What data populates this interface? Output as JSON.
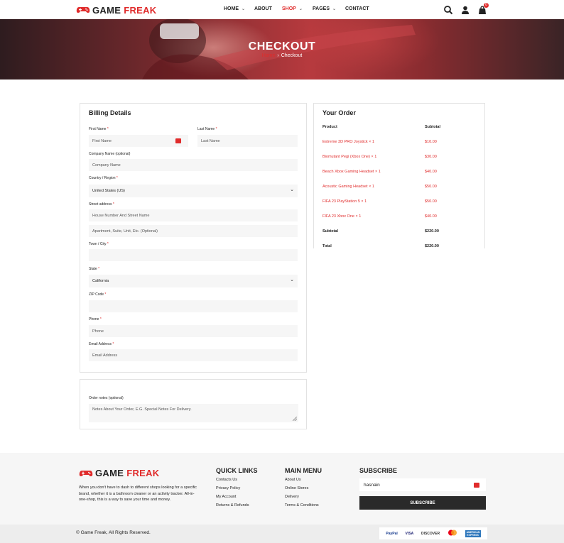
{
  "brand": {
    "word1": "GAME",
    "word2": "FREAK"
  },
  "nav": {
    "items": [
      {
        "label": "HOME",
        "dropdown": true
      },
      {
        "label": "ABOUT",
        "dropdown": false
      },
      {
        "label": "SHOP",
        "dropdown": true,
        "active": true
      },
      {
        "label": "PAGES",
        "dropdown": true
      },
      {
        "label": "CONTACT",
        "dropdown": false
      }
    ],
    "cart_count": "0"
  },
  "hero": {
    "title": "CHECKOUT",
    "crumb_home": "Home",
    "crumb_current": "Checkout"
  },
  "billing": {
    "title": "Billing Details",
    "first_name": {
      "label": "First Name",
      "placeholder": "First Name"
    },
    "last_name": {
      "label": "Last Name",
      "placeholder": "Last Name"
    },
    "company": {
      "label": "Company Name (optional)",
      "placeholder": "Company Name"
    },
    "country": {
      "label": "Country / Region",
      "value": "United States (US)"
    },
    "street": {
      "label": "Street address",
      "placeholder1": "House Number And Street Name",
      "placeholder2": "Apartment, Suite, Unit, Etc. (Optional)"
    },
    "city": {
      "label": "Town / City",
      "value": ""
    },
    "state": {
      "label": "State",
      "value": "California"
    },
    "zip": {
      "label": "ZIP Code",
      "value": ""
    },
    "phone": {
      "label": "Phone",
      "placeholder": "Phone"
    },
    "email": {
      "label": "Email Address",
      "placeholder": "Email Address"
    }
  },
  "notes": {
    "label": "Order notes (optional)",
    "placeholder": "Notes About Your Order, E.G. Special Notes For Delivery."
  },
  "order": {
    "title": "Your Order",
    "col_product": "Product",
    "col_subtotal": "Subtotal",
    "items": [
      {
        "name": "Extreme 3D PRO Joystick  × 1",
        "price": "$10.00"
      },
      {
        "name": "Biomutant Pegi (Xbox One)  × 1",
        "price": "$30.00"
      },
      {
        "name": "Beach Xbox Gaming Headset  × 1",
        "price": "$40.00"
      },
      {
        "name": "Acoustic Gaming Headset  × 1",
        "price": "$50.00"
      },
      {
        "name": "FIFA 23 PlayStation 5  × 1",
        "price": "$50.00"
      },
      {
        "name": "FIFA 23 Xbox One  × 1",
        "price": "$40.00"
      }
    ],
    "subtotal_label": "Subtotal",
    "subtotal_value": "$220.00",
    "total_label": "Total",
    "total_value": "$220.00"
  },
  "footer": {
    "description": "When you don't have to dash to different shops looking for a specific brand, whether it is a bathroom cleaner or an activity tracker. All-in-one-shop, this is a way to save your time and money.",
    "quick_links": {
      "title": "QUICK LINKS",
      "items": [
        "Contacts Us",
        "Privacy Policy",
        "My Account",
        "Returns & Refunds"
      ]
    },
    "main_menu": {
      "title": "MAIN MENU",
      "items": [
        "About Us",
        "Online Stores",
        "Delivery",
        "Terms & Conditions"
      ]
    },
    "subscribe": {
      "title": "SUBSCRIBE",
      "input_value": "hasnain",
      "button": "SUBSCRIBE"
    },
    "copyright": "© Game Freak, All Rights Reserved.",
    "payments": [
      "PayPal",
      "VISA",
      "DISCOVER",
      "mastercard",
      "AMERICAN EXPRESS"
    ]
  },
  "colors": {
    "accent": "#e02b2b",
    "dark": "#2a2a2a",
    "footer_bg": "#f6f6f6"
  }
}
